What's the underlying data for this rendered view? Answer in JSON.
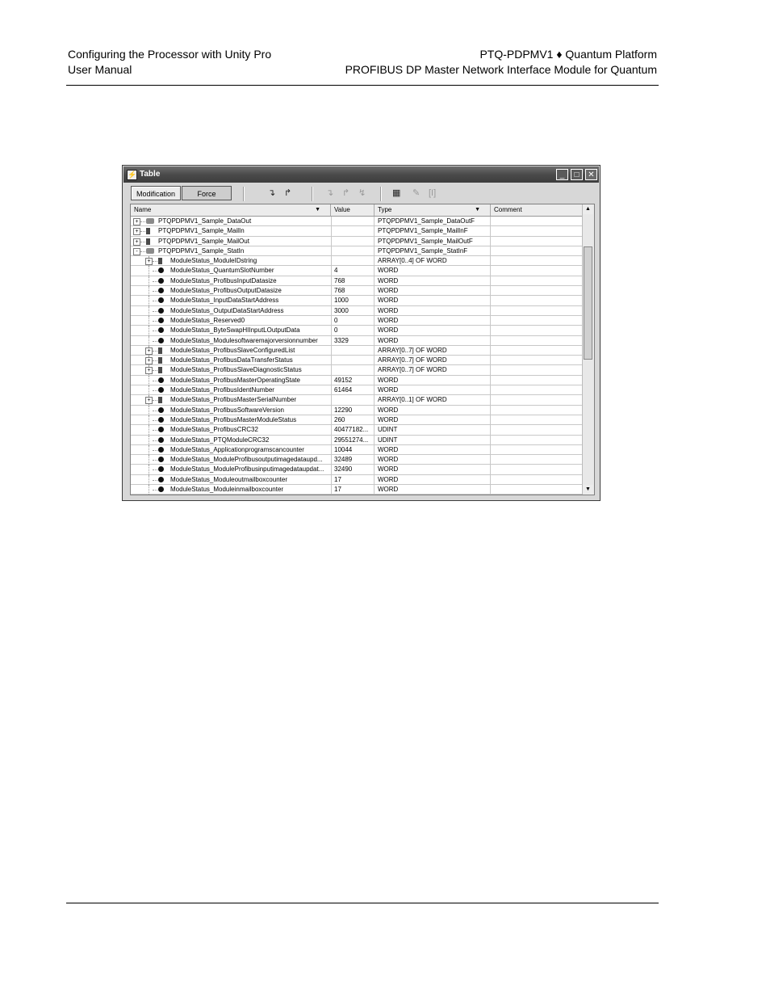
{
  "header": {
    "left_line1": "Configuring the Processor with Unity Pro",
    "left_line2": "User Manual",
    "right_line1": "PTQ-PDPMV1 ♦ Quantum Platform",
    "right_line2": "PROFIBUS DP Master Network Interface Module for Quantum"
  },
  "window": {
    "title": "Table",
    "tabs": {
      "modification": "Modification",
      "force": "Force"
    },
    "columns": {
      "name": "Name",
      "value": "Value",
      "type": "Type",
      "comment": "Comment"
    },
    "rows": [
      {
        "name": "PTQPDPMV1_Sample_DataOut",
        "value": "",
        "type": "PTQPDPMV1_Sample_DataOutF",
        "kind": "folder",
        "level": 0,
        "expander": "+"
      },
      {
        "name": "PTQPDPMV1_Sample_MailIn",
        "value": "",
        "type": "PTQPDPMV1_Sample_MailInF",
        "kind": "array",
        "level": 0,
        "expander": "+"
      },
      {
        "name": "PTQPDPMV1_Sample_MailOut",
        "value": "",
        "type": "PTQPDPMV1_Sample_MailOutF",
        "kind": "array",
        "level": 0,
        "expander": "+"
      },
      {
        "name": "PTQPDPMV1_Sample_StatIn",
        "value": "",
        "type": "PTQPDPMV1_Sample_StatInF",
        "kind": "folder",
        "level": 0,
        "expander": "-"
      },
      {
        "name": "ModuleStatus_ModuleIDstring",
        "value": "",
        "type": "ARRAY[0..4] OF WORD",
        "kind": "array",
        "level": 1,
        "expander": "+"
      },
      {
        "name": "ModuleStatus_QuantumSlotNumber",
        "value": "4",
        "type": "WORD",
        "kind": "dot",
        "level": 1
      },
      {
        "name": "ModuleStatus_ProfibusInputDatasize",
        "value": "768",
        "type": "WORD",
        "kind": "dot",
        "level": 1
      },
      {
        "name": "ModuleStatus_ProfibusOutputDatasize",
        "value": "768",
        "type": "WORD",
        "kind": "dot",
        "level": 1
      },
      {
        "name": "ModuleStatus_InputDataStartAddress",
        "value": "1000",
        "type": "WORD",
        "kind": "dot",
        "level": 1
      },
      {
        "name": "ModuleStatus_OutputDataStartAddress",
        "value": "3000",
        "type": "WORD",
        "kind": "dot",
        "level": 1
      },
      {
        "name": "ModuleStatus_Reserved0",
        "value": "0",
        "type": "WORD",
        "kind": "dot",
        "level": 1
      },
      {
        "name": "ModuleStatus_ByteSwapHIInputLOutputData",
        "value": "0",
        "type": "WORD",
        "kind": "dot",
        "level": 1
      },
      {
        "name": "ModuleStatus_Modulesoftwaremajorversionnumber",
        "value": "3329",
        "type": "WORD",
        "kind": "dot",
        "level": 1
      },
      {
        "name": "ModuleStatus_ProfibusSlaveConfiguredList",
        "value": "",
        "type": "ARRAY[0..7] OF WORD",
        "kind": "array",
        "level": 1,
        "expander": "+"
      },
      {
        "name": "ModuleStatus_ProfibusDataTransferStatus",
        "value": "",
        "type": "ARRAY[0..7] OF WORD",
        "kind": "array",
        "level": 1,
        "expander": "+"
      },
      {
        "name": "ModuleStatus_ProfibusSlaveDiagnosticStatus",
        "value": "",
        "type": "ARRAY[0..7] OF WORD",
        "kind": "array",
        "level": 1,
        "expander": "+"
      },
      {
        "name": "ModuleStatus_ProfibusMasterOperatingState",
        "value": "49152",
        "type": "WORD",
        "kind": "dot",
        "level": 1
      },
      {
        "name": "ModuleStatus_ProfibusIdentNumber",
        "value": "61464",
        "type": "WORD",
        "kind": "dot",
        "level": 1
      },
      {
        "name": "ModuleStatus_ProfibusMasterSerialNumber",
        "value": "",
        "type": "ARRAY[0..1] OF WORD",
        "kind": "array",
        "level": 1,
        "expander": "+"
      },
      {
        "name": "ModuleStatus_ProfibusSoftwareVersion",
        "value": "12290",
        "type": "WORD",
        "kind": "dot",
        "level": 1
      },
      {
        "name": "ModuleStatus_ProfibusMasterModuleStatus",
        "value": "260",
        "type": "WORD",
        "kind": "dot",
        "level": 1
      },
      {
        "name": "ModuleStatus_ProfibusCRC32",
        "value": "40477182...",
        "type": "UDINT",
        "kind": "dot",
        "level": 1
      },
      {
        "name": "ModuleStatus_PTQModuleCRC32",
        "value": "29551274...",
        "type": "UDINT",
        "kind": "dot",
        "level": 1
      },
      {
        "name": "ModuleStatus_Applicationprogramscancounter",
        "value": "10044",
        "type": "WORD",
        "kind": "dot",
        "level": 1
      },
      {
        "name": "ModuleStatus_ModuleProfibusoutputimagedataupd...",
        "value": "32489",
        "type": "WORD",
        "kind": "dot",
        "level": 1
      },
      {
        "name": "ModuleStatus_ModuleProfibusinputimagedataupdat...",
        "value": "32490",
        "type": "WORD",
        "kind": "dot",
        "level": 1
      },
      {
        "name": "ModuleStatus_Moduleoutmailboxcounter",
        "value": "17",
        "type": "WORD",
        "kind": "dot",
        "level": 1
      },
      {
        "name": "ModuleStatus_Moduleinmailboxcounter",
        "value": "17",
        "type": "WORD",
        "kind": "dot",
        "level": 1
      }
    ]
  }
}
